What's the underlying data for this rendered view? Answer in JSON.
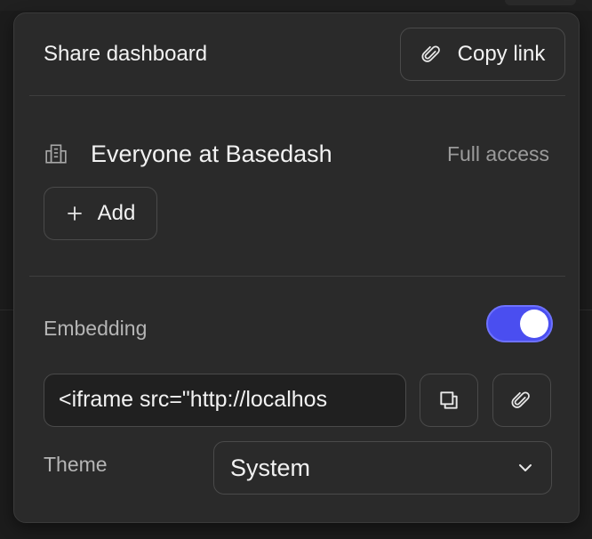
{
  "header": {
    "title": "Share dashboard",
    "copy_link_label": "Copy link"
  },
  "access": {
    "group_name": "Everyone at Basedash",
    "permission": "Full access",
    "add_label": "Add"
  },
  "embedding": {
    "label": "Embedding",
    "enabled": true,
    "embed_code": "<iframe src=\"http://localhos",
    "theme_label": "Theme",
    "theme_value": "System"
  },
  "colors": {
    "accent": "#4a4ef0",
    "panel_bg": "#2a2a2a"
  },
  "icons": {
    "copy_link": "paperclip-icon",
    "group": "building-icon",
    "add": "plus-icon",
    "copy": "copy-icon",
    "link": "paperclip-icon",
    "dropdown": "chevron-down-icon"
  }
}
